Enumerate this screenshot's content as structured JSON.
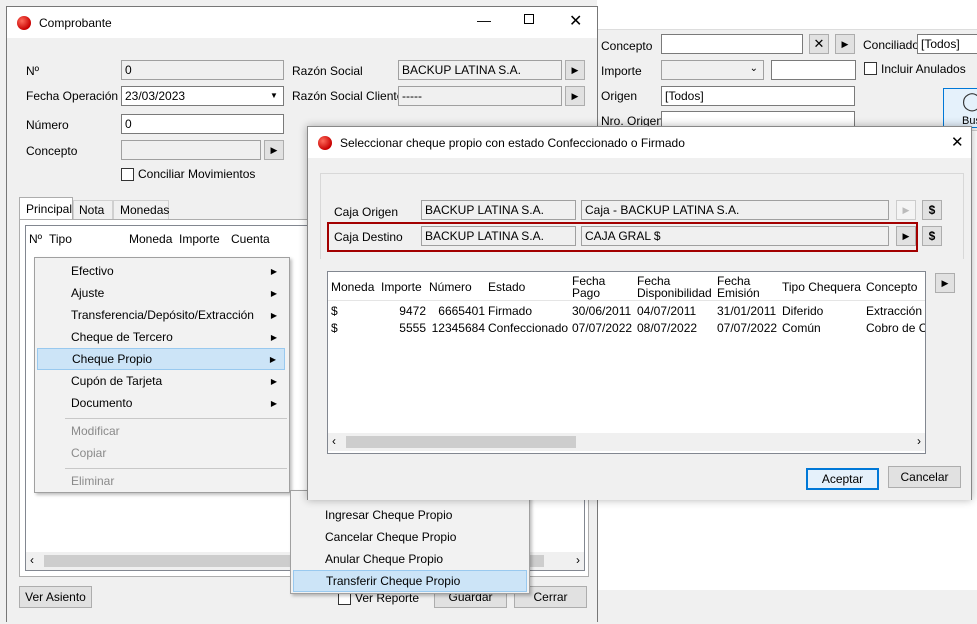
{
  "background": {
    "concepto_label": "Concepto",
    "importe_label": "Importe",
    "origen_label": "Origen",
    "origen_value": "[Todos]",
    "nro_origen_label": "Nro. Origen",
    "conciliado_label": "Conciliado",
    "conciliado_value": "[Todos]",
    "incluir_anulados_label": "Incluir Anulados",
    "search_button_partial": "Bus"
  },
  "comprobante": {
    "title": "Comprobante",
    "nro_label": "Nº",
    "nro_value": "0",
    "fecha_label": "Fecha Operación",
    "fecha_value": "23/03/2023",
    "numero_label": "Número",
    "numero_value": "0",
    "concepto_label": "Concepto",
    "concepto_value": "",
    "razon_social_label": "Razón Social",
    "razon_social_value": "BACKUP LATINA S.A.",
    "razon_social_cliente_label": "Razón Social Cliente",
    "razon_social_cliente_value": "-----",
    "conciliar_label": "Conciliar Movimientos",
    "tabs": [
      "Principal",
      "Nota",
      "Monedas"
    ],
    "grid_headers": [
      "Nº",
      "Tipo",
      "Moneda",
      "Importe",
      "Cuenta"
    ],
    "ver_asiento": "Ver Asiento",
    "ver_reporte": "Ver Reporte",
    "guardar": "Guardar",
    "cerrar": "Cerrar"
  },
  "context_menu": {
    "items": [
      "Efectivo",
      "Ajuste",
      "Transferencia/Depósito/Extracción",
      "Cheque de Tercero",
      "Cheque Propio",
      "Cupón de Tarjeta",
      "Documento"
    ],
    "disabled": [
      "Modificar",
      "Copiar",
      "Eliminar"
    ]
  },
  "submenu": {
    "items": [
      "Ingresar Cheque Propio",
      "Cancelar Cheque Propio",
      "Anular Cheque Propio",
      "Transferir Cheque Propio"
    ]
  },
  "dialog": {
    "title": "Seleccionar cheque propio con estado Confeccionado o Firmado",
    "caja_origen_label": "Caja Origen",
    "caja_origen_empresa": "BACKUP LATINA S.A.",
    "caja_origen_caja": "Caja - BACKUP LATINA S.A.",
    "caja_destino_label": "Caja Destino",
    "caja_destino_empresa": "BACKUP LATINA S.A.",
    "caja_destino_caja": "CAJA GRAL $",
    "currency_symbol": "$",
    "columns": [
      {
        "l1": "Moneda",
        "l2": ""
      },
      {
        "l1": "Importe",
        "l2": ""
      },
      {
        "l1": "Número",
        "l2": ""
      },
      {
        "l1": "Estado",
        "l2": ""
      },
      {
        "l1": "Fecha",
        "l2": "Pago"
      },
      {
        "l1": "Fecha",
        "l2": "Disponibilidad"
      },
      {
        "l1": "Fecha",
        "l2": "Emisión"
      },
      {
        "l1": "Tipo Chequera",
        "l2": ""
      },
      {
        "l1": "Concepto",
        "l2": ""
      }
    ],
    "rows": [
      [
        "$",
        "9472",
        "6665401",
        "Firmado",
        "30/06/2011",
        "04/07/2011",
        "31/01/2011",
        "Diferido",
        "Extracción d"
      ],
      [
        "$",
        "5555",
        "12345684",
        "Confeccionado",
        "07/07/2022",
        "08/07/2022",
        "07/07/2022",
        "Común",
        "Cobro de Ch"
      ]
    ],
    "aceptar": "Aceptar",
    "cancelar": "Cancelar",
    "accent_color": "#a30000"
  }
}
